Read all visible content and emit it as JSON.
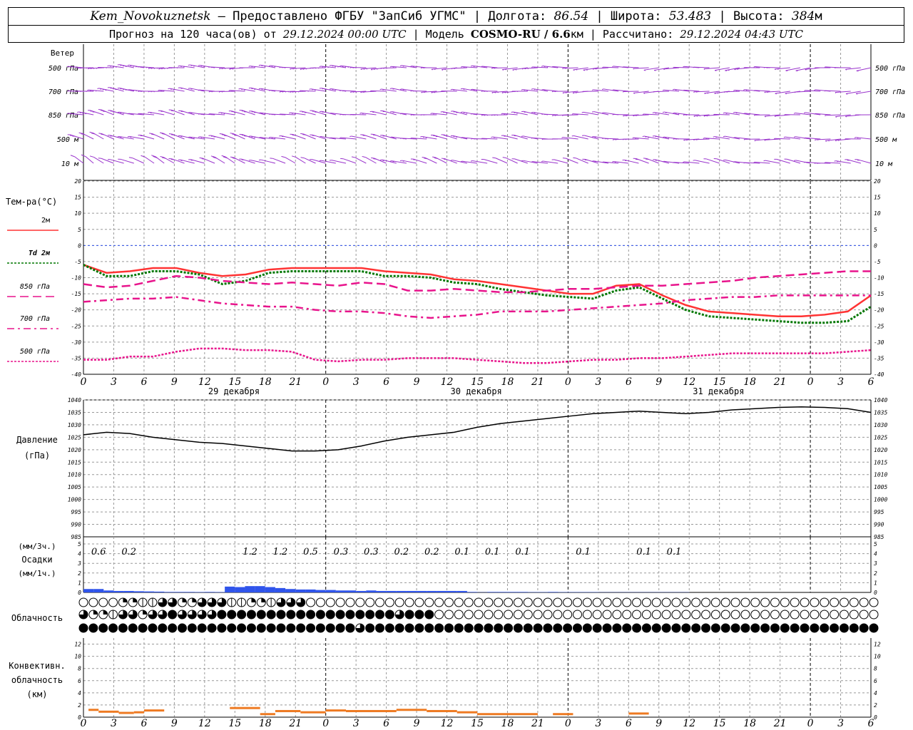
{
  "header": {
    "station": "Kem_Novokuznetsk",
    "dash": " – ",
    "provider": "Предоставлено ФГБУ \"ЗапСиб УГМС\"",
    "sep": " | ",
    "lon_label": "Долгота:",
    "lon": "86.54",
    "lat_label": "Широта:",
    "lat": "53.483",
    "alt_label": "Высота:",
    "alt": "384",
    "alt_unit": "м",
    "fc_prefix": "Прогноз на 120 часа(ов) от",
    "fc_time": "29.12.2024 00:00 UTC",
    "model_label": "Модель",
    "model": "COSMO-RU / 6.6",
    "model_unit": "км",
    "calc_label": "Рассчитано:",
    "calc_time": "29.12.2024 04:43 UTC"
  },
  "chart_data": {
    "type": "line",
    "x_hours": [
      0,
      3,
      6,
      9,
      12,
      15,
      18,
      21,
      24,
      27,
      30,
      33,
      36,
      39,
      42,
      45,
      48,
      51,
      54,
      57,
      60,
      63,
      66,
      69,
      72,
      75,
      78,
      81,
      84,
      87,
      90,
      93,
      96,
      99,
      102
    ],
    "x_tick_labels": [
      "0",
      "3",
      "6",
      "9",
      "12",
      "15",
      "18",
      "21",
      "0",
      "3",
      "6",
      "9",
      "12",
      "15",
      "18",
      "21",
      "0",
      "3",
      "6",
      "9",
      "12",
      "15",
      "18",
      "21",
      "0",
      "3",
      "6"
    ],
    "day_labels": [
      {
        "hour": 12,
        "label": "29 декабря"
      },
      {
        "hour": 36,
        "label": "30 декабря"
      },
      {
        "hour": 60,
        "label": "31 декабря"
      }
    ],
    "wind": {
      "title": "Ветер",
      "levels": [
        "500 гПа",
        "700 гПа",
        "850 гПа",
        "500 м",
        "10 м"
      ],
      "barb_color": "#9933cc"
    },
    "temperature": {
      "title": "Тем-ра(°C)",
      "ylim": [
        -40,
        20
      ],
      "yticks": [
        20,
        15,
        10,
        5,
        0,
        -5,
        -10,
        -15,
        -20,
        -25,
        -30,
        -35,
        -40
      ],
      "series": [
        {
          "name": "2м",
          "color": "#ff3333",
          "style": "solid",
          "values": [
            -6,
            -8.5,
            -8,
            -7,
            -7,
            -8.5,
            -9.5,
            -9,
            -7.5,
            -7,
            -7,
            -7,
            -7,
            -8,
            -8.5,
            -9,
            -10.5,
            -11,
            -12,
            -13,
            -14,
            -15,
            -15,
            -12.5,
            -12,
            -15.5,
            -18.5,
            -20.5,
            -21,
            -21.5,
            -22,
            -22,
            -21.5,
            -20.5,
            -15.5
          ]
        },
        {
          "name": "Td 2м",
          "color": "#007700",
          "style": "dot",
          "values": [
            -6,
            -9.5,
            -9.5,
            -8,
            -8,
            -9,
            -12,
            -11,
            -8.5,
            -8,
            -8,
            -8,
            -8,
            -9.5,
            -9.5,
            -10,
            -11.5,
            -12,
            -13.5,
            -14.5,
            -15.5,
            -16,
            -16.5,
            -14,
            -13,
            -16.5,
            -20,
            -22,
            -22.5,
            -23,
            -23.5,
            -24,
            -24,
            -23.5,
            -19
          ]
        },
        {
          "name": "850 гПа",
          "color": "#e8148c",
          "style": "dash",
          "values": [
            -12,
            -13,
            -12.5,
            -11,
            -9.5,
            -10,
            -11,
            -11.5,
            -12,
            -11.5,
            -12,
            -12.5,
            -11.5,
            -12,
            -14,
            -14,
            -13.5,
            -14,
            -14.5,
            -14.5,
            -14,
            -13.5,
            -13.5,
            -13,
            -12.5,
            -12.5,
            -12,
            -11.5,
            -11,
            -10,
            -9.5,
            -9,
            -8.5,
            -8,
            -8
          ]
        },
        {
          "name": "700 гПа",
          "color": "#e8148c",
          "style": "dashdot",
          "values": [
            -17.5,
            -17,
            -16.5,
            -16.5,
            -16,
            -17,
            -18,
            -18.5,
            -19,
            -19,
            -20,
            -20.5,
            -20.5,
            -21,
            -22,
            -22.5,
            -22,
            -21.5,
            -20.5,
            -20.5,
            -20.5,
            -20,
            -19.5,
            -19,
            -18.5,
            -18,
            -17,
            -16.5,
            -16,
            -16,
            -15.5,
            -15.5,
            -15.5,
            -15.5,
            -15.5
          ]
        },
        {
          "name": "500 гПа",
          "color": "#e8148c",
          "style": "dot",
          "values": [
            -35.5,
            -35.5,
            -34.5,
            -34.5,
            -33,
            -32,
            -32,
            -32.5,
            -32.5,
            -33,
            -35.5,
            -36,
            -35.5,
            -35.5,
            -35,
            -35,
            -35,
            -35.5,
            -36,
            -36.5,
            -36.5,
            -36,
            -35.5,
            -35.5,
            -35,
            -35,
            -34.5,
            -34,
            -33.5,
            -33.5,
            -33.5,
            -33.5,
            -33.5,
            -33,
            -32.5
          ]
        }
      ]
    },
    "pressure": {
      "title": "Давление",
      "unit": "(гПа)",
      "ylim": [
        985,
        1040
      ],
      "yticks": [
        1040,
        1035,
        1030,
        1025,
        1020,
        1015,
        1010,
        1005,
        1000,
        995,
        990,
        985
      ],
      "color": "#000000",
      "values": [
        1026,
        1027,
        1026.5,
        1025,
        1024,
        1023,
        1022.5,
        1021.5,
        1020.5,
        1019.5,
        1019.5,
        1020,
        1021.5,
        1023.5,
        1025,
        1026,
        1027,
        1029,
        1030.5,
        1031.5,
        1032.5,
        1033.5,
        1034.5,
        1035,
        1035.5,
        1035,
        1034.5,
        1035,
        1036,
        1036.5,
        1037,
        1037.2,
        1037,
        1036.5,
        1035
      ]
    },
    "precip": {
      "title_3h": "(мм/3ч.)",
      "title": "Осадки",
      "title_1h": "(мм/1ч.)",
      "ylim": [
        0,
        5
      ],
      "yticks": [
        5,
        4,
        3,
        2,
        1,
        0
      ],
      "color": "#2f54eb",
      "values_3h": [
        0.6,
        0.2,
        null,
        null,
        null,
        1.2,
        1.2,
        0.5,
        0.3,
        0.3,
        0.2,
        0.2,
        0.1,
        0.1,
        0.1,
        null,
        0.1,
        null,
        0.1,
        0.1,
        null,
        null,
        null,
        null,
        null,
        null
      ],
      "labels": [
        {
          "hour": 1.5,
          "text": "0.6"
        },
        {
          "hour": 4.5,
          "text": "0.2"
        },
        {
          "hour": 16.5,
          "text": "1.2"
        },
        {
          "hour": 19.5,
          "text": "1.2"
        },
        {
          "hour": 22.5,
          "text": "0.5"
        },
        {
          "hour": 25.5,
          "text": "0.3"
        },
        {
          "hour": 28.5,
          "text": "0.3"
        },
        {
          "hour": 31.5,
          "text": "0.2"
        },
        {
          "hour": 34.5,
          "text": "0.2"
        },
        {
          "hour": 37.5,
          "text": "0.1"
        },
        {
          "hour": 40.5,
          "text": "0.1"
        },
        {
          "hour": 43.5,
          "text": "0.1"
        },
        {
          "hour": 49.5,
          "text": "0.1"
        },
        {
          "hour": 55.5,
          "text": "0.1"
        },
        {
          "hour": 58.5,
          "text": "0.1"
        }
      ],
      "values_1h": [
        0.35,
        0.35,
        0.2,
        0.15,
        0.15,
        0.12,
        0.1,
        0.08,
        0.05,
        0.05,
        0.05,
        0.04,
        0.05,
        0.04,
        0.6,
        0.55,
        0.65,
        0.65,
        0.55,
        0.45,
        0.35,
        0.3,
        0.3,
        0.25,
        0.25,
        0.2,
        0.2,
        0.15,
        0.2,
        0.15,
        0.15,
        0.15,
        0.15,
        0.15,
        0.15,
        0.15,
        0.15,
        0.15,
        0.05,
        0.02,
        0.05,
        0.05,
        0.05,
        0.05,
        0.03,
        0.03,
        0.05,
        0.03,
        0.03,
        0.03,
        0.03,
        0.02,
        0.02,
        0.02,
        0.02,
        0.02,
        0.02,
        0.02,
        0.02,
        0.02,
        0,
        0,
        0,
        0,
        0,
        0,
        0,
        0,
        0,
        0,
        0,
        0,
        0,
        0,
        0,
        0,
        0,
        0,
        0
      ]
    },
    "clouds": {
      "title": "Облачность",
      "rows": [
        [
          0,
          0,
          0,
          0,
          2,
          2,
          1,
          1,
          3,
          3,
          2,
          2,
          3,
          3,
          3,
          1,
          1,
          2,
          2,
          1,
          3,
          3,
          3,
          0,
          0,
          0,
          0,
          0,
          0,
          0,
          0,
          0,
          0,
          0,
          0,
          0,
          0,
          0,
          0,
          0,
          0,
          0,
          0,
          0,
          0,
          0,
          0,
          0,
          0,
          0,
          0,
          0,
          0,
          0,
          0,
          0,
          0,
          0,
          0,
          0,
          0,
          0,
          0,
          0,
          0,
          0,
          0,
          0,
          0,
          0,
          0,
          0,
          0,
          0,
          0,
          0,
          0,
          0,
          0,
          0,
          0
        ],
        [
          3,
          2,
          2,
          1,
          3,
          3,
          2,
          3,
          3,
          4,
          3,
          3,
          3,
          3,
          4,
          4,
          4,
          4,
          4,
          4,
          4,
          4,
          4,
          4,
          4,
          4,
          4,
          4,
          4,
          4,
          4,
          4,
          3,
          4,
          4,
          4,
          0,
          0,
          0,
          0,
          0,
          0,
          0,
          0,
          0,
          0,
          0,
          0,
          0,
          0,
          0,
          0,
          0,
          0,
          0,
          0,
          0,
          0,
          0,
          0,
          0,
          0,
          0,
          0,
          0,
          0,
          0,
          0,
          0,
          0,
          0,
          0,
          0,
          0,
          0,
          0,
          0,
          0,
          0,
          0,
          0
        ],
        [
          4,
          4,
          4,
          4,
          4,
          4,
          4,
          4,
          4,
          4,
          4,
          4,
          4,
          4,
          4,
          4,
          4,
          4,
          4,
          4,
          4,
          4,
          4,
          4,
          4,
          4,
          4,
          4,
          3,
          4,
          4,
          4,
          4,
          4,
          4,
          4,
          4,
          4,
          4,
          4,
          4,
          4,
          4,
          4,
          4,
          4,
          4,
          4,
          4,
          4,
          4,
          4,
          4,
          4,
          4,
          4,
          4,
          4,
          4,
          4,
          4,
          4,
          4,
          4,
          4,
          4,
          4,
          4,
          4,
          4,
          4,
          4,
          4,
          4,
          4,
          4,
          4,
          4,
          4,
          4,
          4
        ]
      ]
    },
    "convective": {
      "title_1": "Конвективн.",
      "title_2": "облачность",
      "title_3": "(км)",
      "ylim": [
        0,
        13
      ],
      "yticks": [
        12,
        10,
        8,
        6,
        4,
        2,
        0
      ],
      "color": "#ee7a22",
      "segments": [
        {
          "x0": 0.5,
          "x1": 1.5,
          "y": 1.2
        },
        {
          "x0": 1.5,
          "x1": 3.5,
          "y": 0.9
        },
        {
          "x0": 3.5,
          "x1": 5,
          "y": 0.7
        },
        {
          "x0": 5,
          "x1": 6,
          "y": 0.8
        },
        {
          "x0": 6,
          "x1": 8,
          "y": 1.1
        },
        {
          "x0": 14.5,
          "x1": 17.5,
          "y": 1.5
        },
        {
          "x0": 17.5,
          "x1": 19,
          "y": 0.5
        },
        {
          "x0": 19,
          "x1": 21.5,
          "y": 1.0
        },
        {
          "x0": 21.5,
          "x1": 24,
          "y": 0.8
        },
        {
          "x0": 24,
          "x1": 26,
          "y": 1.1
        },
        {
          "x0": 26,
          "x1": 31,
          "y": 1.0
        },
        {
          "x0": 31,
          "x1": 34,
          "y": 1.2
        },
        {
          "x0": 34,
          "x1": 37,
          "y": 1.0
        },
        {
          "x0": 37,
          "x1": 39,
          "y": 0.8
        },
        {
          "x0": 39,
          "x1": 45,
          "y": 0.5
        },
        {
          "x0": 46.5,
          "x1": 48.5,
          "y": 0.5
        },
        {
          "x0": 54,
          "x1": 56,
          "y": 0.6
        }
      ]
    }
  }
}
